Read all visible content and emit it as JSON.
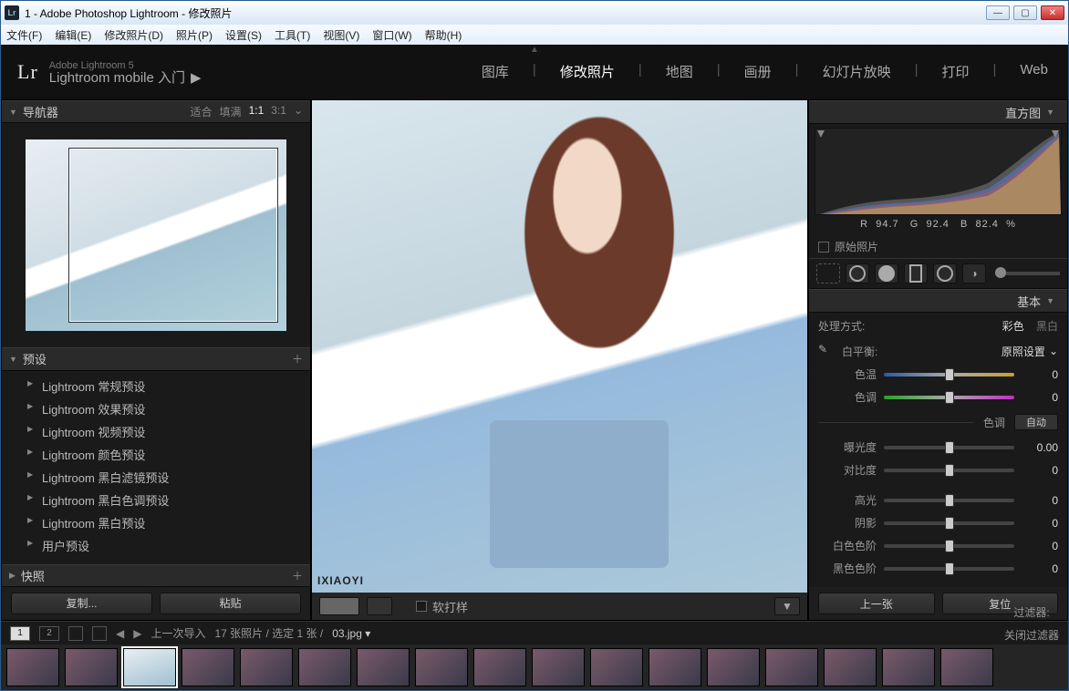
{
  "window": {
    "title": "1 - Adobe Photoshop Lightroom - 修改照片"
  },
  "menubar": [
    "文件(F)",
    "编辑(E)",
    "修改照片(D)",
    "照片(P)",
    "设置(S)",
    "工具(T)",
    "视图(V)",
    "窗口(W)",
    "帮助(H)"
  ],
  "header": {
    "brand_small": "Adobe Lightroom 5",
    "brand_sub": "Lightroom mobile 入门",
    "tabs": [
      "图库",
      "修改照片",
      "地图",
      "画册",
      "幻灯片放映",
      "打印",
      "Web"
    ],
    "active_tab": "修改照片"
  },
  "left": {
    "navigator": {
      "title": "导航器",
      "zooms": [
        "适合",
        "填满",
        "1:1",
        "3:1"
      ]
    },
    "presets": {
      "title": "预设",
      "items": [
        "Lightroom 常规预设",
        "Lightroom 效果预设",
        "Lightroom 视频预设",
        "Lightroom 颜色预设",
        "Lightroom 黑白滤镜预设",
        "Lightroom 黑白色调预设",
        "Lightroom 黑白预设",
        "用户预设"
      ]
    },
    "snapshots": {
      "title": "快照"
    },
    "copy": "复制...",
    "paste": "粘贴"
  },
  "center": {
    "watermark": "IXIAOYI",
    "softproof": "软打样"
  },
  "right": {
    "histogram": {
      "title": "直方图",
      "rgb": {
        "R": "94.7",
        "G": "92.4",
        "B": "82.4",
        "suffix": "%"
      }
    },
    "original": "原始照片",
    "basic": {
      "title": "基本",
      "process_label": "处理方式:",
      "opt_color": "彩色",
      "opt_bw": "黑白",
      "wb_label": "白平衡:",
      "wb_value": "原照设置",
      "temp_label": "色温",
      "temp_val": "0",
      "tint_label": "色调",
      "tint_val": "0",
      "tone_label": "色调",
      "auto": "自动",
      "expo_label": "曝光度",
      "expo_val": "0.00",
      "contrast_label": "对比度",
      "contrast_val": "0",
      "highlights_label": "高光",
      "highlights_val": "0",
      "shadows_label": "阴影",
      "shadows_val": "0",
      "whites_label": "白色色阶",
      "whites_val": "0",
      "blacks_label": "黑色色阶",
      "blacks_val": "0"
    },
    "prev": "上一张",
    "reset": "复位"
  },
  "secondary": {
    "import_label": "上一次导入",
    "count_text": "17 张照片 / 选定 1 张 /",
    "filename": "03.jpg",
    "filter_label": "过滤器:",
    "filter_value": "关闭过滤器"
  }
}
